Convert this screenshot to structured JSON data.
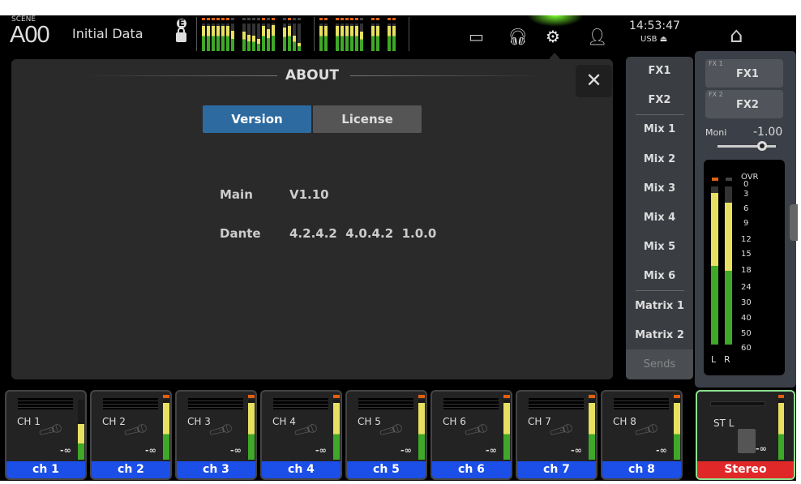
{
  "header": {
    "scene_label": "SCENE",
    "scene_number": "A00",
    "scene_name": "Initial Data",
    "edit_badge": "E",
    "clock": "14:53:47",
    "usb": "USB ⏏"
  },
  "top_meters": [
    [
      0.9,
      0.9,
      0.9,
      0.9,
      0.9,
      0.9,
      0.75
    ],
    [
      0.7,
      0.6,
      0.55,
      0.45,
      0.9,
      0.8,
      0.95
    ],
    [
      0.85,
      0.9,
      0.55,
      0.3
    ],
    [
      0.9,
      0.9
    ],
    [
      0.9,
      0.9,
      0.9,
      0.9,
      0.9,
      0.7
    ],
    [
      0.9,
      0.9
    ],
    [
      0.9,
      0.9
    ]
  ],
  "about": {
    "title": "ABOUT",
    "close": "✕",
    "tabs": [
      "Version",
      "License"
    ],
    "active_tab": "Version",
    "rows": [
      {
        "label": "Main",
        "value": "V1.10"
      },
      {
        "label": "Dante",
        "value": "4.2.4.2  4.0.4.2  1.0.0"
      }
    ]
  },
  "sends": {
    "items": [
      "FX1",
      "FX2",
      "Mix 1",
      "Mix 2",
      "Mix 3",
      "Mix 4",
      "Mix 5",
      "Mix 6",
      "Matrix 1",
      "Matrix 2"
    ],
    "button": "Sends"
  },
  "right_panel": {
    "fx": [
      {
        "slot": "FX 1",
        "name": "FX1"
      },
      {
        "slot": "FX 2",
        "name": "FX2"
      }
    ],
    "moni_label": "Moni",
    "moni_value": "-1.00",
    "meter": {
      "ovr": "OVR",
      "scale": [
        "0",
        "3",
        "6",
        "9",
        "12",
        "15",
        "18",
        "24",
        "30",
        "40",
        "50",
        "60"
      ],
      "l": "L",
      "r": "R",
      "l_level": 0.96,
      "r_level": 0.9
    }
  },
  "channels": [
    {
      "name": "CH 1",
      "label": "ch 1",
      "level": 0.6,
      "inf": "-∞"
    },
    {
      "name": "CH 2",
      "label": "ch 2",
      "level": 0.95,
      "inf": "-∞"
    },
    {
      "name": "CH 3",
      "label": "ch 3",
      "level": 0.95,
      "inf": "-∞"
    },
    {
      "name": "CH 4",
      "label": "ch 4",
      "level": 0.95,
      "inf": "-∞"
    },
    {
      "name": "CH 5",
      "label": "ch 5",
      "level": 0.95,
      "inf": "-∞"
    },
    {
      "name": "CH 6",
      "label": "ch 6",
      "level": 0.95,
      "inf": "-∞"
    },
    {
      "name": "CH 7",
      "label": "ch 7",
      "level": 0.95,
      "inf": "-∞"
    },
    {
      "name": "CH 8",
      "label": "ch 8",
      "level": 0.95,
      "inf": "-∞"
    }
  ],
  "stereo": {
    "name": "ST L",
    "label": "Stereo",
    "inf": "-∞",
    "level": 0.95
  },
  "colors": {
    "channel_label": "#1c4fe8",
    "stereo_label": "#e02828",
    "active_tab": "#2c6aa0"
  }
}
